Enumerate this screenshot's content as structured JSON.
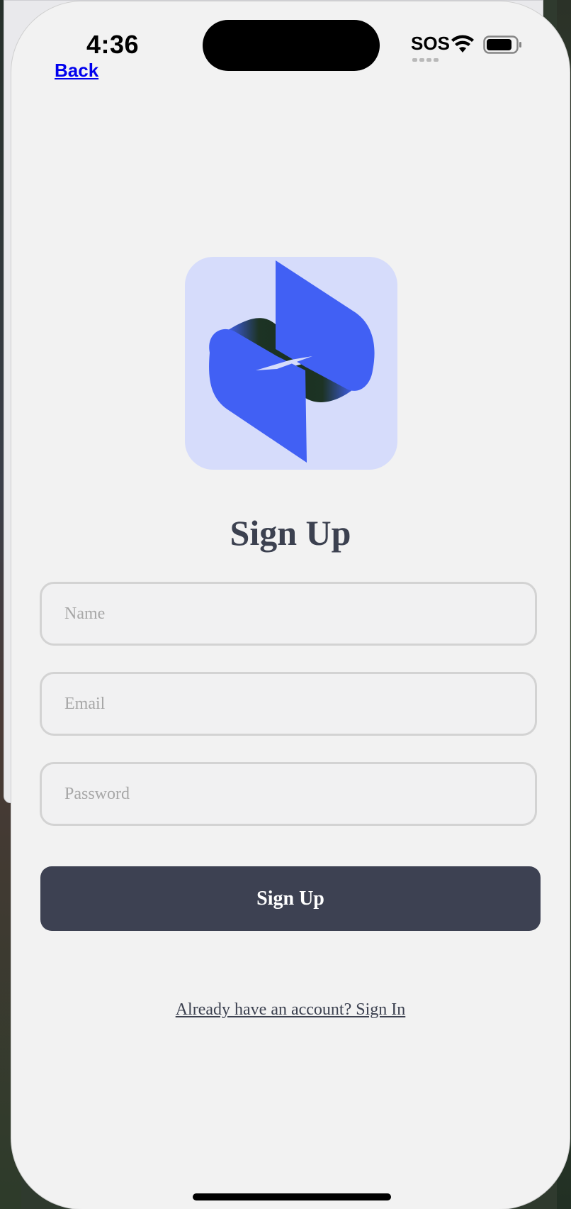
{
  "status_bar": {
    "time": "4:36",
    "carrier": "SOS",
    "wifi_icon": "wifi-icon",
    "battery_icon": "battery-icon"
  },
  "nav": {
    "back_label": "Back"
  },
  "logo": {
    "icon": "app-logo-icon",
    "colors": {
      "background": "#d6dcfb",
      "primary": "#4160f4",
      "dark": "#17301f"
    }
  },
  "form": {
    "title": "Sign Up",
    "name_placeholder": "Name",
    "name_value": "",
    "email_placeholder": "Email",
    "email_value": "",
    "password_placeholder": "Password",
    "password_value": "",
    "submit_label": "Sign Up",
    "signin_link_label": "Already have an account? Sign In"
  },
  "colors": {
    "screen_background": "#f2f2f2",
    "button_background": "#3d4152",
    "link": "#0000ee",
    "title": "#3c4150"
  }
}
